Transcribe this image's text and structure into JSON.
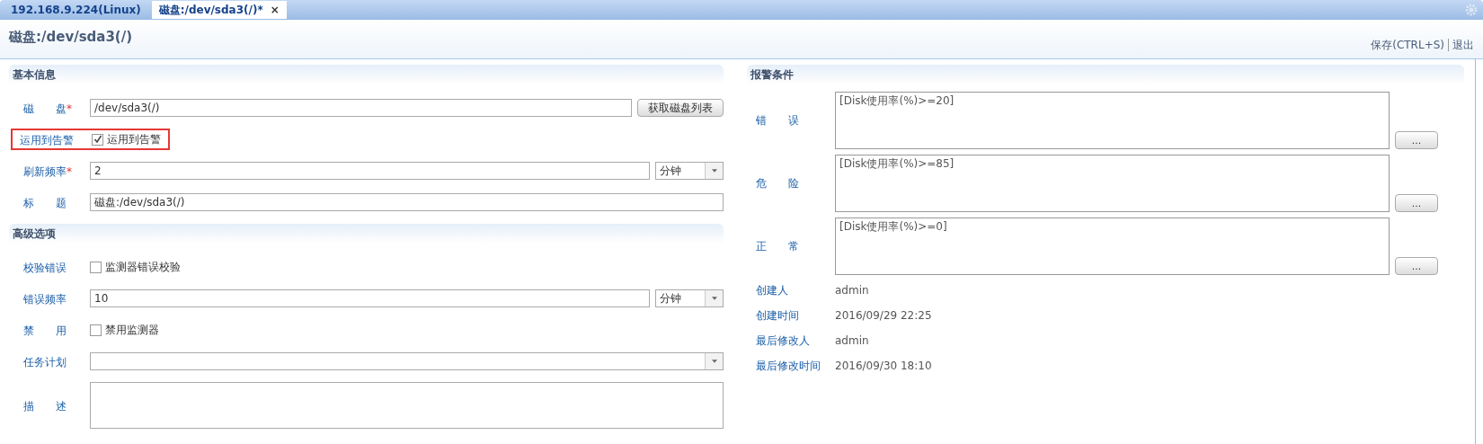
{
  "tabs": [
    {
      "label": "192.168.9.224(Linux)",
      "selected": false
    },
    {
      "label": "磁盘:/dev/sda3(/)*",
      "selected": true,
      "close": "×"
    }
  ],
  "page_title": "磁盘:/dev/sda3(/)",
  "actions": [
    "保存(CTRL+S)",
    "退出"
  ],
  "basic": {
    "title": "基本信息",
    "rows": [
      {
        "kind": "text",
        "label": "磁　　盘",
        "required_mark": "*",
        "value": "/dev/sda3(/)",
        "button": "获取磁盘列表"
      },
      {
        "kind": "checkbox",
        "label": "运用到告警",
        "checked": true,
        "text": "运用到告警",
        "highlighted": true
      },
      {
        "kind": "select",
        "label": "刷新频率",
        "required_mark": "*",
        "value": "2",
        "unit": "分钟"
      },
      {
        "kind": "text",
        "label": "标　　题",
        "value": "磁盘:/dev/sda3(/)"
      }
    ]
  },
  "advanced": {
    "title": "高级选项",
    "rows": [
      {
        "kind": "checkbox",
        "label": "校验错误",
        "checked": false,
        "text": "监测器错误校验"
      },
      {
        "kind": "select",
        "label": "错误频率",
        "value": "10",
        "unit": "分钟"
      },
      {
        "kind": "checkbox",
        "label": "禁　　用",
        "checked": false,
        "text": "禁用监测器"
      },
      {
        "kind": "dropdown",
        "label": "任务计划"
      },
      {
        "kind": "textarea",
        "label": "描　　述"
      }
    ]
  },
  "alarm": {
    "title": "报警条件",
    "conditions": [
      {
        "label": "错　　误",
        "value": "[Disk使用率(%)>=20]",
        "button": "..."
      },
      {
        "label": "危　　险",
        "value": "[Disk使用率(%)>=85]",
        "button": "..."
      },
      {
        "label": "正　　常",
        "value": "[Disk使用率(%)>=0]",
        "button": "..."
      }
    ],
    "info": [
      {
        "label": "创建人",
        "value": "admin"
      },
      {
        "label": "创建时间",
        "value": "2016/09/29 22:25"
      },
      {
        "label": "最后修改人",
        "value": "admin"
      },
      {
        "label": "最后修改时间",
        "value": "2016/09/30 18:10"
      }
    ]
  }
}
